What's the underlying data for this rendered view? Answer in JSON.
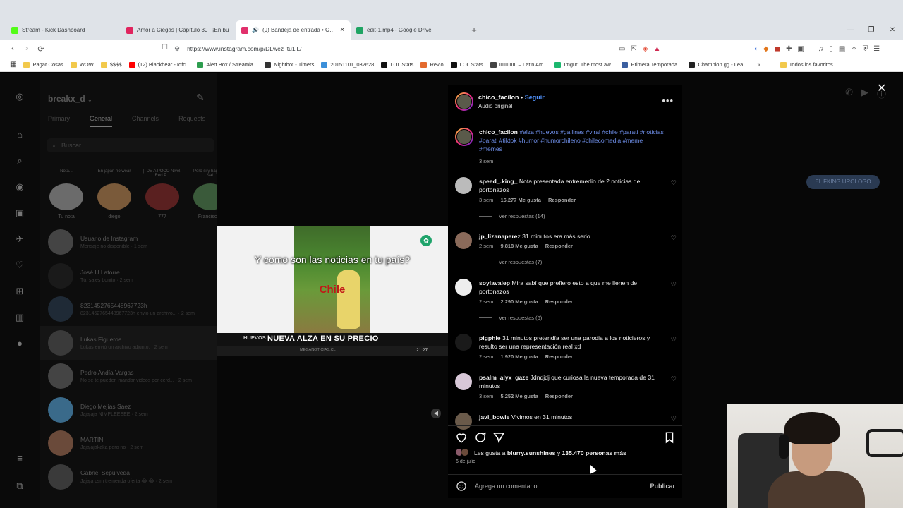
{
  "browser": {
    "tabs": [
      {
        "title": "Stream - Kick Dashboard",
        "color": "#53fc18",
        "active": false
      },
      {
        "title": "Amor a Ciegas | Capítulo 30 | ¡En bu",
        "color": "#e0245e",
        "active": false
      },
      {
        "title": "(9) Bandeja de entrada • Chat",
        "color": "#e1306c",
        "active": true
      },
      {
        "title": "edit-1.mp4 - Google Drive",
        "color": "#1fa463",
        "active": false
      }
    ],
    "url": "https://www.instagram.com/p/DLwez_tu1iL/",
    "bookmarks": [
      {
        "label": "Pagar Cosas",
        "color": "#f2c94c"
      },
      {
        "label": "WOW",
        "color": "#f2c94c"
      },
      {
        "label": "$$$$",
        "color": "#f2c94c"
      },
      {
        "label": "(12) Blackbear - Idfc...",
        "color": "#ff0000"
      },
      {
        "label": "Alert Box / Streamla...",
        "color": "#2d9d4f"
      },
      {
        "label": "Nightbot - Timers",
        "color": "#333333"
      },
      {
        "label": "20151101_032628",
        "color": "#3b8fd9"
      },
      {
        "label": "LOL Stats",
        "color": "#111111"
      },
      {
        "label": "Revlo",
        "color": "#e46b2e"
      },
      {
        "label": "LOL Stats",
        "color": "#111111"
      },
      {
        "label": "IIIIIIIIIIII – Latin Am...",
        "color": "#444444"
      },
      {
        "label": "Imgur: The most aw...",
        "color": "#1bb76e"
      },
      {
        "label": "Primera Temporada...",
        "color": "#3b5fa0"
      },
      {
        "label": "Champion.gg - Lea...",
        "color": "#222222"
      }
    ],
    "favorites_label": "Todos los favoritos"
  },
  "dm": {
    "username": "breakx_d",
    "tabs": [
      "Primary",
      "General",
      "Channels",
      "Requests"
    ],
    "selected_tab": "General",
    "search_placeholder": "Buscar",
    "notes": [
      {
        "bubble": "Nota...",
        "name": "Tu nota",
        "color": "#6b6b6b"
      },
      {
        "bubble": "En japan no wear",
        "name": "diego",
        "color": "#7a5a3a"
      },
      {
        "bubble": "|| DE A POCO Nivel, Red P...",
        "name": "777",
        "color": "#5a2020"
      },
      {
        "bubble": "Pero si y hago est sal",
        "name": "Francisco I",
        "color": "#3a5a3a"
      }
    ],
    "conversations": [
      {
        "name": "Usuario de Instagram",
        "msg": "Mensaje no disponible · 1 sem",
        "color": "#444444"
      },
      {
        "name": "José U Latorre",
        "msg": "Tú: sales bonito · 2 sem",
        "color": "#1a1a1a"
      },
      {
        "name": "8231452765448967723h",
        "msg": "8231452765448967723h envió un archivo... · 2 sem",
        "color": "#1f2a36"
      },
      {
        "name": "Lukas Figueroa",
        "msg": "Lukas envió un archivo adjunto. · 2 sem",
        "color": "#3a3a3a"
      },
      {
        "name": "Pedro Andía Vargas",
        "msg": "No se te pueden mandar videos por cerd... · 2 sem",
        "color": "#444444"
      },
      {
        "name": "Diego Mejías Saez",
        "msg": "Jajajaja ÑIMPLEEEEE · 2 sem",
        "color": "#3a6a8a"
      },
      {
        "name": "MARTIN",
        "msg": "Jajajajakaka pero no · 2 sem",
        "color": "#6a4a3a"
      },
      {
        "name": "Gabriel Sepulveda",
        "msg": "Jajaja csm tremenda oferta 😂 😂 · 2 sem",
        "color": "#3a3a3a"
      }
    ],
    "chat_bubble": "EL FKING UROLOGO"
  },
  "video": {
    "caption_line": "Y como son las noticias en tu país?",
    "caption_country": "Chile",
    "lower_tag": "HUEVOS",
    "headline": "NUEVA ALZA EN SU PRECIO",
    "site": "MEGANOTICIAS.CL",
    "timestamp": "21:27"
  },
  "post": {
    "author": "chico_facilon",
    "follow_label": "Seguir",
    "audio": "Audio original",
    "caption_author": "chico_facilon",
    "caption_tags": "#alza #huevos #gallinas #viral #chile #parati #noticias #parati #tiktok #humor #humorchileno #chilecomedia #meme #memes",
    "caption_time": "3 sem",
    "comments": [
      {
        "user": "speed_.king_",
        "text": "Nota presentada entremedio de 2 noticias de portonazos",
        "time": "3 sem",
        "likes": "16.277 Me gusta",
        "reply": "Responder",
        "replies": "Ver respuestas (14)",
        "color": "#bbbbbb"
      },
      {
        "user": "jp_lizanaperez",
        "text": "31 minutos era más serio",
        "time": "2 sem",
        "likes": "9.818 Me gusta",
        "reply": "Responder",
        "replies": "Ver respuestas (7)",
        "color": "#8a6a5a"
      },
      {
        "user": "soylavalep",
        "text": "Mira sabí que prefiero esto a que me llenen de portonazos",
        "time": "2 sem",
        "likes": "2.290 Me gusta",
        "reply": "Responder",
        "replies": "Ver respuestas (6)",
        "color": "#eeeeee"
      },
      {
        "user": "pigphie",
        "text": "31 minutos pretendía ser una parodia a los noticieros y resulto ser una representación real xd",
        "time": "2 sem",
        "likes": "1.920 Me gusta",
        "reply": "Responder",
        "replies": "",
        "color": "#1a1a1a"
      },
      {
        "user": "psalm_alyx_gaze",
        "text": "Jdndjdj que curiosa la nueva temporada de 31 minutos",
        "time": "3 sem",
        "likes": "5.252 Me gusta",
        "reply": "Responder",
        "replies": "",
        "color": "#d8c8d8"
      },
      {
        "user": "javi_bowie",
        "text": "Vivimos en 31 minutos",
        "time": "",
        "likes": "",
        "reply": "",
        "replies": "",
        "color": "#6a5a4a"
      }
    ],
    "likes_prefix": "Les gusta a",
    "likes_user": "blurry.sunshines",
    "likes_and": "y",
    "likes_count": "135.470 personas más",
    "date": "6 de julio",
    "comment_placeholder": "Agrega un comentario...",
    "publish_label": "Publicar"
  }
}
